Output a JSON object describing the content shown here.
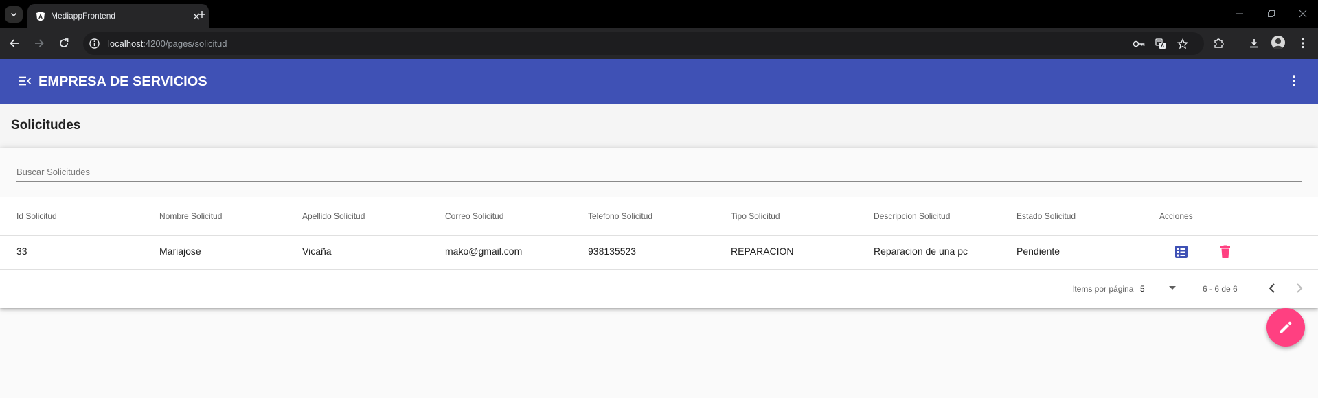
{
  "browser": {
    "tab_title": "MediappFrontend",
    "url_host": "localhost",
    "url_path": ":4200/pages/solicitud"
  },
  "header": {
    "title": "EMPRESA DE SERVICIOS"
  },
  "page": {
    "title": "Solicitudes",
    "search_placeholder": "Buscar Solicitudes"
  },
  "table": {
    "columns": [
      "Id Solicitud",
      "Nombre Solicitud",
      "Apellido Solicitud",
      "Correo Solicitud",
      "Telefono Solicitud",
      "Tipo Solicitud",
      "Descripcion Solicitud",
      "Estado Solicitud",
      "Acciones"
    ],
    "rows": [
      [
        "33",
        "Mariajose",
        "Vicaña",
        "mako@gmail.com",
        "938135523",
        "REPARACION",
        "Reparacion de una pc",
        "Pendiente"
      ]
    ]
  },
  "paginator": {
    "items_label": "Items por página",
    "page_size": "5",
    "range": "6 - 6 de 6"
  },
  "colors": {
    "primary": "#3f51b5",
    "accent": "#ff4081",
    "delete": "#ff4081"
  }
}
